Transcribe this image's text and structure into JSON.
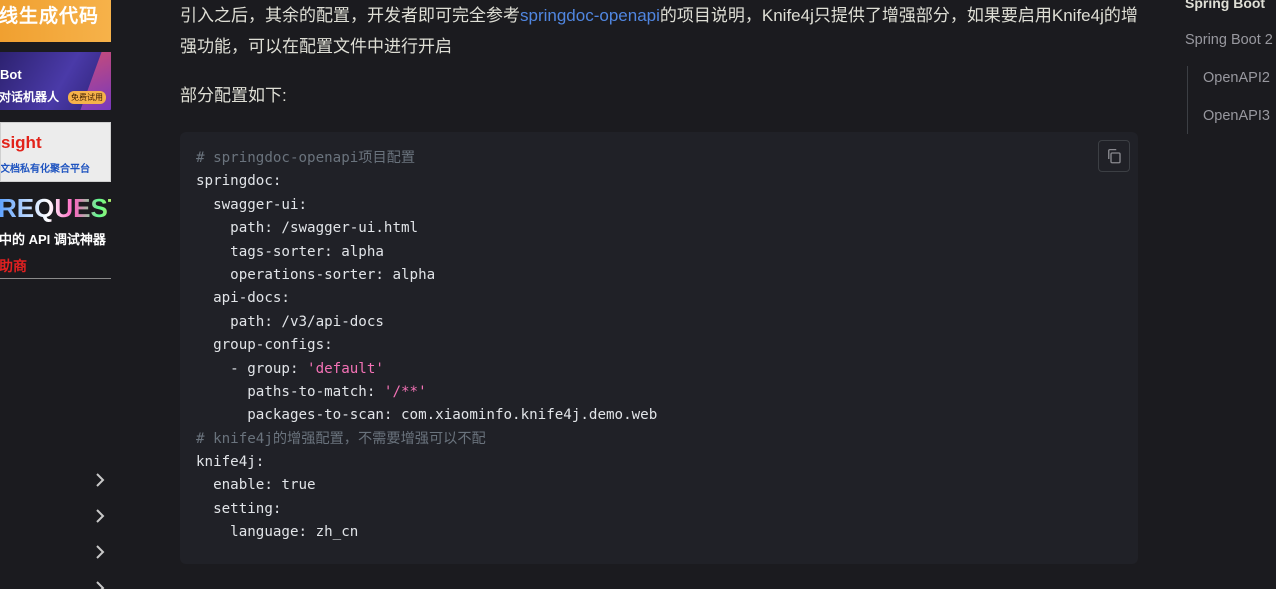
{
  "sidebar": {
    "ads": [
      {
        "line1": "线生成代码"
      },
      {
        "line1": "Bot",
        "line2": "对话机器人",
        "badge": "免费试用"
      },
      {
        "line1": "sight",
        "line2": "文档私有化聚合平台"
      },
      {
        "line1": "REQUEST",
        "line2": "中的 API 调试神器"
      }
    ],
    "sponsor_label": "助商"
  },
  "article": {
    "para1_before": "引入之后，其余的配置，开发者即可完全参考",
    "para1_link": "springdoc-openapi",
    "para1_after": "的项目说明，Knife4j只提供了增强部分，如果要启用Knife4j的增强功能，可以在配置文件中进行开启",
    "para2": "部分配置如下:"
  },
  "code": {
    "lines": {
      "l1": "# springdoc-openapi项目配置",
      "l2": "springdoc:",
      "l3": "  swagger-ui:",
      "l4": "    path: /swagger-ui.html",
      "l5": "    tags-sorter: alpha",
      "l6": "    operations-sorter: alpha",
      "l7": "  api-docs:",
      "l8": "    path: /v3/api-docs",
      "l9": "  group-configs:",
      "l10_key": "    - group: ",
      "l10_val": "'default'",
      "l11_key": "      paths-to-match: ",
      "l11_val": "'/**'",
      "l12": "      packages-to-scan: com.xiaominfo.knife4j.demo.web",
      "l13": "# knife4j的增强配置，不需要增强可以不配",
      "l14": "knife4j:",
      "l15": "  enable: true",
      "l16": "  setting:",
      "l17": "    language: zh_cn"
    }
  },
  "outline": {
    "title": "Spring Boot",
    "item": "Spring Boot 2",
    "sub_items": [
      "OpenAPI2",
      "OpenAPI3"
    ]
  },
  "icons": {
    "copy": "copy-icon",
    "chevron": "chevron-right-icon"
  },
  "colors": {
    "background": "#1b1b1f",
    "code_background": "#202127",
    "link": "#5086e0",
    "code_comment": "#6a737d",
    "code_string": "#f472b6",
    "text": "#dfdfd6"
  }
}
